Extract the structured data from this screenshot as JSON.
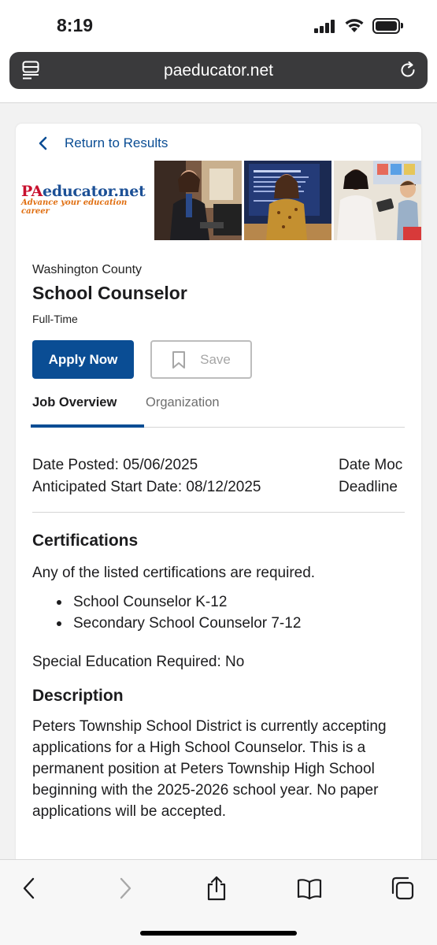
{
  "status_bar": {
    "time": "8:19",
    "icons": [
      "cellular-signal-icon",
      "wifi-icon",
      "battery-icon"
    ]
  },
  "browser": {
    "url": "paeducator.net",
    "icons": [
      "reader-mode-icon",
      "reload-icon"
    ],
    "toolbar_icons": [
      "back-icon",
      "forward-icon",
      "share-icon",
      "bookmarks-icon",
      "tabs-icon"
    ]
  },
  "page": {
    "return_link": "Return to Results",
    "logo": {
      "text_pa": "PA",
      "text_rest": "educator.net",
      "tagline": "Advance your education career"
    },
    "job": {
      "county": "Washington County",
      "title": "School Counselor",
      "type": "Full-Time"
    },
    "buttons": {
      "apply": "Apply Now",
      "save": "Save"
    },
    "tabs": [
      {
        "label": "Job Overview",
        "active": true
      },
      {
        "label": "Organization",
        "active": false
      }
    ],
    "dates": {
      "posted": "Date Posted: 05/06/2025",
      "start": "Anticipated Start Date: 08/12/2025",
      "modified": "Date Moc",
      "deadline": "Deadline"
    },
    "certifications": {
      "heading": "Certifications",
      "intro": "Any of the listed certifications are required.",
      "items": [
        "School Counselor K-12",
        "Secondary School Counselor 7-12"
      ],
      "special_ed": "Special Education Required: No"
    },
    "description": {
      "heading": "Description",
      "text": "Peters Township School District is currently accepting applications for a High School Counselor.  This is a permanent position at Peters Township High School beginning with the 2025-2026 school year. No paper applications will be accepted."
    }
  },
  "colors": {
    "brand_blue": "#0a4d94",
    "url_bar": "#3a3a3c",
    "logo_red": "#c8102e",
    "logo_orange": "#e06e10"
  }
}
